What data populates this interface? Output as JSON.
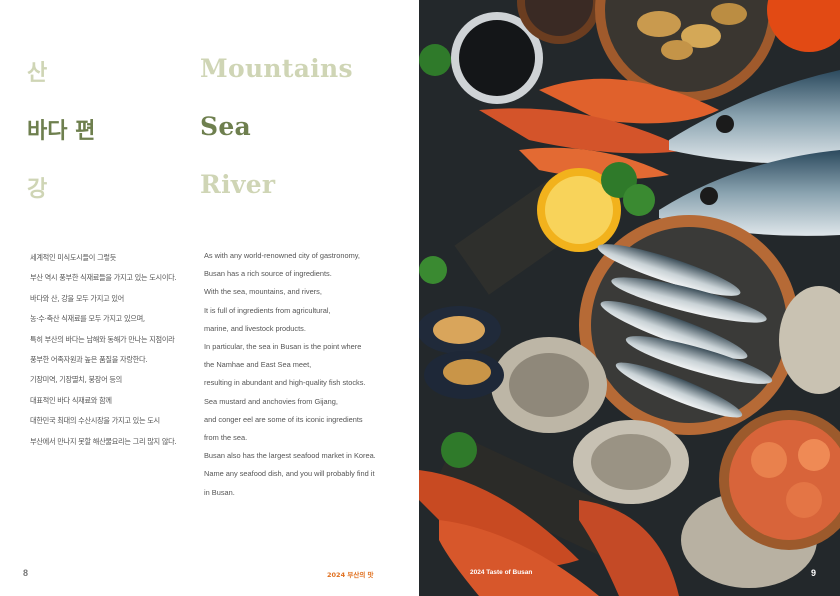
{
  "left_page": {
    "headings_ko": [
      "산",
      "바다 편",
      "강"
    ],
    "headings_en": [
      "Mountains",
      "Sea",
      "River"
    ],
    "body_ko": [
      "세계적인 미식도시들이 그렇듯",
      "부산 역시 풍부한 식재료들을 가지고 있는 도시이다.",
      "바다와 산, 강을 모두 가지고 있어",
      "농·수·축산 식재료를 모두 가지고 있으며,",
      "특히 부산의 바다는 남해와 동해가 만나는 지점이라",
      "풍부한 어족자원과 높은 품질을 자랑한다.",
      "기장미역, 기장멸치, 붕장어 등의",
      "대표적인 바다 식재료와 함께",
      "대한민국 최대의 수산시장을 가지고 있는 도시",
      "부산에서 만나지 못할 해산물요리는 그리 많지 않다."
    ],
    "body_en": [
      "As with any world-renowned city of gastronomy,",
      "Busan has a rich source of ingredients.",
      "With the sea, mountains, and rivers,",
      "It is full of ingredients from agricultural,",
      "marine, and livestock products.",
      "In particular, the sea in Busan is the point where",
      "the Namhae and East Sea meet,",
      "resulting in abundant and high-quality fish stocks.",
      "Sea mustard and anchovies from Gijang,",
      "and conger eel are some of its iconic ingredients",
      "from the sea.",
      "Busan also has the largest seafood market in Korea.",
      "Name any seafood dish, and you will probably find it",
      "in Busan."
    ],
    "page_number": "8",
    "footer": "2024 부산의 맛"
  },
  "right_page": {
    "footer": "2024 Taste of Busan",
    "page_number": "9"
  },
  "colors": {
    "heading_light": "#cfd5b5",
    "heading_dark": "#6e7f4e",
    "footer_accent": "#e0701f"
  }
}
